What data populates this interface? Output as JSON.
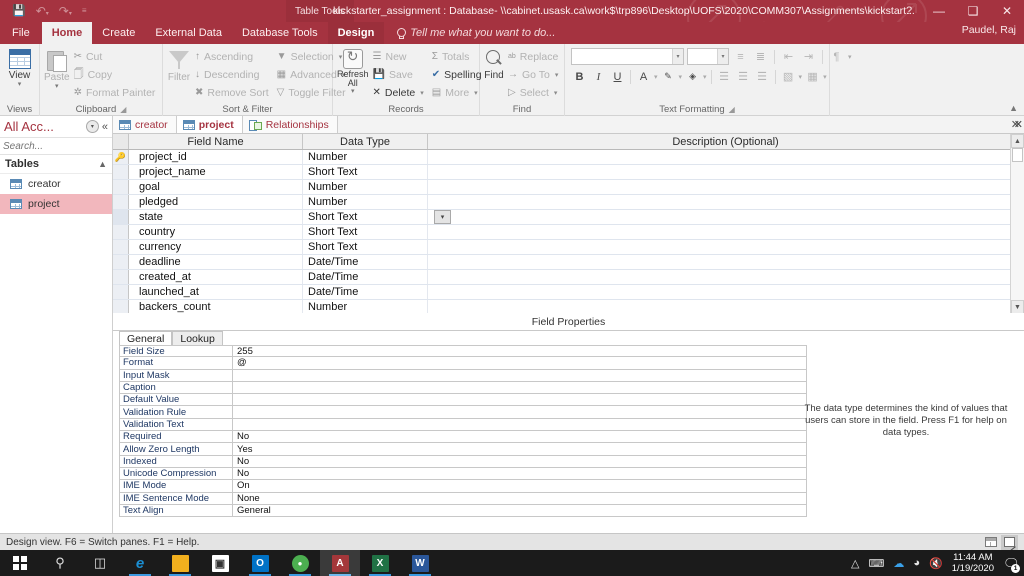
{
  "titlebar": {
    "context_tab_group": "Table Tools",
    "document_title": "kickstarter_assignment : Database- \\\\cabinet.usask.ca\\work$\\trp896\\Desktop\\UOFS\\2020\\COMM307\\Assignments\\kickstart...",
    "quick_access": [
      "save-icon",
      "undo-icon",
      "redo-icon",
      "customize-qat-icon"
    ],
    "help_label": "?",
    "minimize_label": "—",
    "restore_label": "❑",
    "close_label": "✕",
    "user_name": "Paudel, Raj"
  },
  "ribbon": {
    "tabs": [
      {
        "label": "File",
        "active": false
      },
      {
        "label": "Home",
        "active": true
      },
      {
        "label": "Create",
        "active": false
      },
      {
        "label": "External Data",
        "active": false
      },
      {
        "label": "Database Tools",
        "active": false
      }
    ],
    "contextual_tab": "Design",
    "tell_me": "Tell me what you want to do...",
    "groups": [
      {
        "name": "Views",
        "label": "Views",
        "big_button": {
          "label": "View",
          "icon": "datasheet-view-icon",
          "has_dropdown": true
        }
      },
      {
        "name": "Clipboard",
        "label": "Clipboard",
        "big_button": {
          "label": "Paste",
          "icon": "paste-icon",
          "has_dropdown": true,
          "disabled": true
        },
        "items": [
          {
            "label": "Cut",
            "icon": "scissors-icon",
            "disabled": true
          },
          {
            "label": "Copy",
            "icon": "copy-icon",
            "disabled": true
          },
          {
            "label": "Format Painter",
            "icon": "format-painter-icon",
            "disabled": true
          }
        ]
      },
      {
        "name": "Sort & Filter",
        "label": "Sort & Filter",
        "big_button": {
          "label": "Filter",
          "icon": "funnel-icon",
          "disabled": true
        },
        "items": [
          {
            "label": "Ascending",
            "icon": "sort-ascending-icon",
            "disabled": true
          },
          {
            "label": "Descending",
            "icon": "sort-descending-icon",
            "disabled": true
          },
          {
            "label": "Remove Sort",
            "icon": "remove-sort-icon",
            "disabled": true
          },
          {
            "label": "Selection",
            "icon": "selection-filter-icon",
            "disabled": true,
            "has_dropdown": true
          },
          {
            "label": "Advanced",
            "icon": "advanced-filter-icon",
            "disabled": true,
            "has_dropdown": true
          },
          {
            "label": "Toggle Filter",
            "icon": "toggle-filter-icon",
            "disabled": true
          }
        ]
      },
      {
        "name": "Records",
        "label": "Records",
        "big_button": {
          "label": "Refresh All",
          "icon": "refresh-icon",
          "has_dropdown": true
        },
        "items": [
          {
            "label": "New",
            "icon": "new-record-icon",
            "disabled": true
          },
          {
            "label": "Save",
            "icon": "save-record-icon",
            "disabled": true
          },
          {
            "label": "Delete",
            "icon": "delete-icon",
            "has_dropdown": true
          },
          {
            "label": "Totals",
            "icon": "totals-sigma-icon",
            "disabled": true
          },
          {
            "label": "Spelling",
            "icon": "spelling-icon"
          },
          {
            "label": "More",
            "icon": "more-icon",
            "disabled": true,
            "has_dropdown": true
          }
        ]
      },
      {
        "name": "Find",
        "label": "Find",
        "big_button": {
          "label": "Find",
          "icon": "magnifier-icon"
        },
        "items": [
          {
            "label": "Replace",
            "icon": "replace-icon",
            "disabled": true
          },
          {
            "label": "Go To",
            "icon": "go-to-icon",
            "disabled": true,
            "has_dropdown": true
          },
          {
            "label": "Select",
            "icon": "select-icon",
            "disabled": true,
            "has_dropdown": true
          }
        ]
      },
      {
        "name": "Text Formatting",
        "label": "Text Formatting",
        "font_name_value": "",
        "font_size_value": "",
        "buttons": [
          "bullets-icon",
          "numbering-icon",
          "decrease-indent-icon",
          "increase-indent-icon",
          "text-direction-icon",
          "bold-icon",
          "italic-icon",
          "underline-icon",
          "font-color-icon",
          "text-highlight-icon",
          "fill-color-icon",
          "align-left-icon",
          "align-center-icon",
          "align-right-icon",
          "datasheet-format-icon",
          "gridlines-icon"
        ],
        "bold_label": "B",
        "italic_label": "I",
        "underline_label": "U",
        "font_color_label": "A"
      }
    ],
    "collapse_icon": "collapse-ribbon-icon"
  },
  "navpane": {
    "title": "All Acc...",
    "menu_icon": "nav-dropdown-icon",
    "collapse_icon": "shutter-bar-close-icon",
    "search_placeholder": "Search...",
    "search_value": "",
    "search_icon": "search-icon",
    "group_label": "Tables",
    "group_chevron": "chevron-up-icon",
    "items": [
      {
        "label": "creator",
        "icon": "table-icon",
        "selected": false
      },
      {
        "label": "project",
        "icon": "table-icon",
        "selected": true
      }
    ]
  },
  "doctabs": {
    "tabs": [
      {
        "label": "creator",
        "icon": "table-icon",
        "active": false
      },
      {
        "label": "project",
        "icon": "table-icon",
        "active": true
      },
      {
        "label": "Relationships",
        "icon": "relationships-icon",
        "active": false
      }
    ],
    "close_label": "✕"
  },
  "grid": {
    "columns": [
      "Field Name",
      "Data Type",
      "Description (Optional)"
    ],
    "rows": [
      {
        "field_name": "project_id",
        "data_type": "Number",
        "description": "",
        "primary_key": true,
        "selected": false
      },
      {
        "field_name": "project_name",
        "data_type": "Short Text",
        "description": "",
        "primary_key": false,
        "selected": false
      },
      {
        "field_name": "goal",
        "data_type": "Number",
        "description": "",
        "primary_key": false,
        "selected": false
      },
      {
        "field_name": "pledged",
        "data_type": "Number",
        "description": "",
        "primary_key": false,
        "selected": false
      },
      {
        "field_name": "state",
        "data_type": "Short Text",
        "description": "",
        "primary_key": false,
        "selected": true
      },
      {
        "field_name": "country",
        "data_type": "Short Text",
        "description": "",
        "primary_key": false,
        "selected": false
      },
      {
        "field_name": "currency",
        "data_type": "Short Text",
        "description": "",
        "primary_key": false,
        "selected": false
      },
      {
        "field_name": "deadline",
        "data_type": "Date/Time",
        "description": "",
        "primary_key": false,
        "selected": false
      },
      {
        "field_name": "created_at",
        "data_type": "Date/Time",
        "description": "",
        "primary_key": false,
        "selected": false
      },
      {
        "field_name": "launched_at",
        "data_type": "Date/Time",
        "description": "",
        "primary_key": false,
        "selected": false
      },
      {
        "field_name": "backers_count",
        "data_type": "Number",
        "description": "",
        "primary_key": false,
        "selected": false
      }
    ],
    "scroll_up_icon": "scroll-up-icon",
    "scroll_down_icon": "scroll-down-icon",
    "type_dropdown_icon": "chevron-down-icon",
    "key_icon": "primary-key-icon"
  },
  "field_properties": {
    "section_label": "Field Properties",
    "tabs": [
      {
        "label": "General",
        "active": true
      },
      {
        "label": "Lookup",
        "active": false
      }
    ],
    "rows": [
      {
        "key": "Field Size",
        "value": "255"
      },
      {
        "key": "Format",
        "value": "@"
      },
      {
        "key": "Input Mask",
        "value": ""
      },
      {
        "key": "Caption",
        "value": ""
      },
      {
        "key": "Default Value",
        "value": ""
      },
      {
        "key": "Validation Rule",
        "value": ""
      },
      {
        "key": "Validation Text",
        "value": ""
      },
      {
        "key": "Required",
        "value": "No"
      },
      {
        "key": "Allow Zero Length",
        "value": "Yes"
      },
      {
        "key": "Indexed",
        "value": "No"
      },
      {
        "key": "Unicode Compression",
        "value": "No"
      },
      {
        "key": "IME Mode",
        "value": "On"
      },
      {
        "key": "IME Sentence Mode",
        "value": "None"
      },
      {
        "key": "Text Align",
        "value": "General"
      }
    ],
    "help_text": "The data type determines the kind of values that users can store in the field. Press F1 for help on data types."
  },
  "statusbar": {
    "text": "Design view.  F6 = Switch panes.  F1 = Help.",
    "views": [
      {
        "name": "datasheet-view-button",
        "icon": "datasheet-view-icon",
        "active": false
      },
      {
        "name": "design-view-button",
        "icon": "design-view-icon",
        "active": true
      }
    ]
  },
  "taskbar": {
    "start_icon": "windows-start-icon",
    "search_icon": "search-icon",
    "taskview_icon": "task-view-icon",
    "apps": [
      {
        "name": "edge",
        "label": "e",
        "color": "#0f7ec4",
        "running": true,
        "active": false
      },
      {
        "name": "file-explorer",
        "label": "▬",
        "color": "#ffb900",
        "running": true,
        "active": false
      },
      {
        "name": "microsoft-store",
        "label": "⊞",
        "color": "#ffffff",
        "running": false,
        "active": false
      },
      {
        "name": "outlook",
        "label": "O",
        "color": "#0072c6",
        "running": true,
        "active": false
      },
      {
        "name": "chrome",
        "label": "●",
        "color": "#4285f4",
        "running": true,
        "active": false
      },
      {
        "name": "access",
        "label": "A",
        "color": "#a4373a",
        "running": true,
        "active": true
      },
      {
        "name": "excel",
        "label": "X",
        "color": "#207245",
        "running": true,
        "active": false
      },
      {
        "name": "word",
        "label": "W",
        "color": "#2b579a",
        "running": true,
        "active": false
      }
    ],
    "tray": {
      "show_hidden_icon": "chevron-up-icon",
      "icons": [
        "touch-keyboard-icon",
        "onedrive-icon",
        "network-icon",
        "volume-muted-icon"
      ],
      "time": "11:44 AM",
      "date": "1/19/2020",
      "notification_icon": "action-center-icon",
      "notification_count": "1"
    }
  }
}
